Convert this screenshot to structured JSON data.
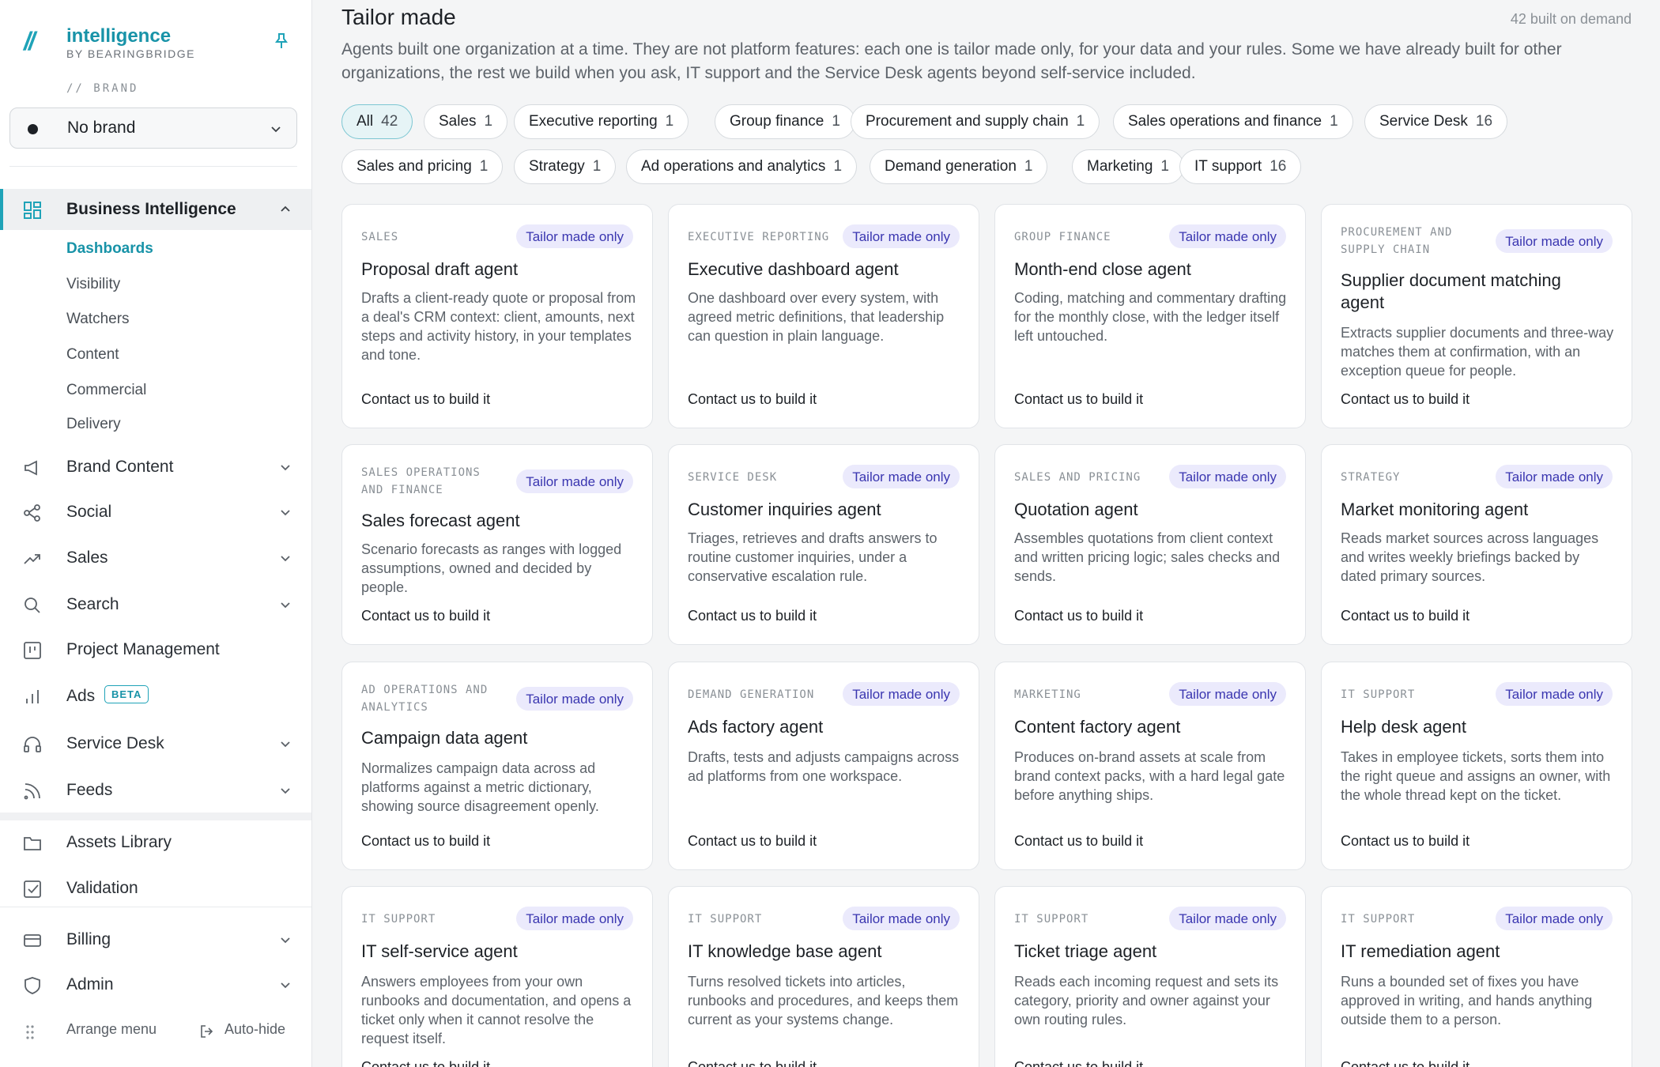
{
  "sidebar": {
    "logo_mark": "//",
    "logo_title": "intelligence",
    "logo_sub": "BY BEARINGBRIDGE",
    "brand_label": "// BRAND",
    "brand_value": "No brand",
    "nav": {
      "business_intelligence": "Business Intelligence",
      "sub": [
        "Dashboards",
        "Visibility",
        "Watchers",
        "Content",
        "Commercial",
        "Delivery"
      ],
      "brand_content": "Brand Content",
      "social": "Social",
      "sales": "Sales",
      "search": "Search",
      "project_management": "Project Management",
      "ads": "Ads",
      "ads_badge": "BETA",
      "service_desk": "Service Desk",
      "feeds": "Feeds",
      "assets_library": "Assets Library",
      "validation": "Validation",
      "billing": "Billing",
      "admin": "Admin"
    },
    "footer": {
      "arrange": "Arrange menu",
      "autohide": "Auto-hide"
    }
  },
  "main": {
    "title": "Tailor made",
    "built_count": "42 built on demand",
    "description": "Agents built one organization at a time. They are not platform features: each one is tailor made only, for your data and your rules. Some we have already built for other organizations, the rest we build when you ask, IT support and the Service Desk agents beyond self-service included.",
    "chips": [
      {
        "label": "All",
        "count": "42"
      },
      {
        "label": "Sales",
        "count": "1"
      },
      {
        "label": "Executive reporting",
        "count": "1"
      },
      {
        "label": "Group finance",
        "count": "1"
      },
      {
        "label": "Procurement and supply chain",
        "count": "1"
      },
      {
        "label": "Sales operations and finance",
        "count": "1"
      },
      {
        "label": "Service Desk",
        "count": "16"
      },
      {
        "label": "Sales and pricing",
        "count": "1"
      },
      {
        "label": "Strategy",
        "count": "1"
      },
      {
        "label": "Ad operations and analytics",
        "count": "1"
      },
      {
        "label": "Demand generation",
        "count": "1"
      },
      {
        "label": "Marketing",
        "count": "1"
      },
      {
        "label": "IT support",
        "count": "16"
      }
    ],
    "badge_label": "Tailor made only",
    "cta_label": "Contact us to build it",
    "cards": [
      {
        "category": "SALES",
        "title": "Proposal draft agent",
        "desc": "Drafts a client-ready quote or proposal from a deal's CRM context: client, amounts, next steps and activity history, in your templates and tone."
      },
      {
        "category": "EXECUTIVE REPORTING",
        "title": "Executive dashboard agent",
        "desc": "One dashboard over every system, with agreed metric definitions, that leadership can question in plain language."
      },
      {
        "category": "GROUP FINANCE",
        "title": "Month-end close agent",
        "desc": "Coding, matching and commentary drafting for the monthly close, with the ledger itself left untouched."
      },
      {
        "category": "PROCUREMENT AND SUPPLY CHAIN",
        "title": "Supplier document matching agent",
        "desc": "Extracts supplier documents and three-way matches them at confirmation, with an exception queue for people."
      },
      {
        "category": "SALES OPERATIONS AND FINANCE",
        "title": "Sales forecast agent",
        "desc": "Scenario forecasts as ranges with logged assumptions, owned and decided by people."
      },
      {
        "category": "SERVICE DESK",
        "title": "Customer inquiries agent",
        "desc": "Triages, retrieves and drafts answers to routine customer inquiries, under a conservative escalation rule."
      },
      {
        "category": "SALES AND PRICING",
        "title": "Quotation agent",
        "desc": "Assembles quotations from client context and written pricing logic; sales checks and sends."
      },
      {
        "category": "STRATEGY",
        "title": "Market monitoring agent",
        "desc": "Reads market sources across languages and writes weekly briefings backed by dated primary sources."
      },
      {
        "category": "AD OPERATIONS AND ANALYTICS",
        "title": "Campaign data agent",
        "desc": "Normalizes campaign data across ad platforms against a metric dictionary, showing source disagreement openly."
      },
      {
        "category": "DEMAND GENERATION",
        "title": "Ads factory agent",
        "desc": "Drafts, tests and adjusts campaigns across ad platforms from one workspace."
      },
      {
        "category": "MARKETING",
        "title": "Content factory agent",
        "desc": "Produces on-brand assets at scale from brand context packs, with a hard legal gate before anything ships."
      },
      {
        "category": "IT SUPPORT",
        "title": "Help desk agent",
        "desc": "Takes in employee tickets, sorts them into the right queue and assigns an owner, with the whole thread kept on the ticket."
      },
      {
        "category": "IT SUPPORT",
        "title": "IT self-service agent",
        "desc": "Answers employees from your own runbooks and documentation, and opens a ticket only when it cannot resolve the request itself."
      },
      {
        "category": "IT SUPPORT",
        "title": "IT knowledge base agent",
        "desc": "Turns resolved tickets into articles, runbooks and procedures, and keeps them current as your systems change."
      },
      {
        "category": "IT SUPPORT",
        "title": "Ticket triage agent",
        "desc": "Reads each incoming request and sets its category, priority and owner against your own routing rules."
      },
      {
        "category": "IT SUPPORT",
        "title": "IT remediation agent",
        "desc": "Runs a bounded set of fixes you have approved in writing, and hands anything outside them to a person."
      }
    ]
  },
  "colors": {
    "accent": "#1fa3b8",
    "badge_bg": "#ebeafc",
    "badge_text": "#3a36b0"
  }
}
